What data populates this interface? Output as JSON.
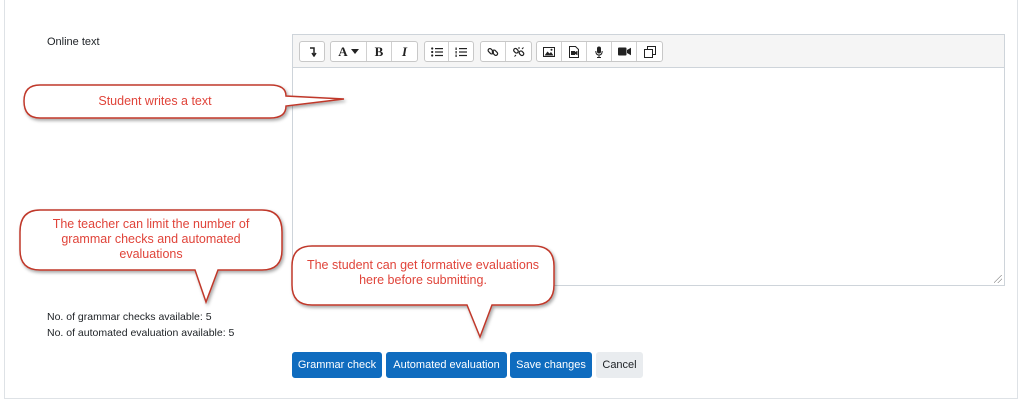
{
  "form": {
    "online_text_label": "Online text"
  },
  "toolbar": {
    "groups": [
      [
        "collapse-icon"
      ],
      [
        "font-style-icon",
        "bold-icon",
        "italic-icon"
      ],
      [
        "bullet-list-icon",
        "numbered-list-icon"
      ],
      [
        "link-icon",
        "unlink-icon"
      ],
      [
        "image-icon",
        "media-icon",
        "record-audio-icon",
        "record-video-icon",
        "manage-files-icon"
      ]
    ],
    "font_glyph": "A",
    "bold_glyph": "B",
    "italic_glyph": "I"
  },
  "info": {
    "grammar_checks": "No. of grammar checks available: 5",
    "automated_evaluations": "No. of automated evaluation available: 5"
  },
  "buttons": {
    "grammar_check": "Grammar check",
    "automated_evaluation": "Automated evaluation",
    "save_changes": "Save changes",
    "cancel": "Cancel"
  },
  "callouts": {
    "student_writes": "Student writes a text",
    "teacher_limit": "The teacher can limit the number of grammar checks and automated evaluations",
    "formative": "The student can get formative evaluations here before submitting."
  },
  "colors": {
    "primary": "#0f6cbf",
    "callout_text": "#e0443a",
    "callout_border": "#c0392b"
  }
}
